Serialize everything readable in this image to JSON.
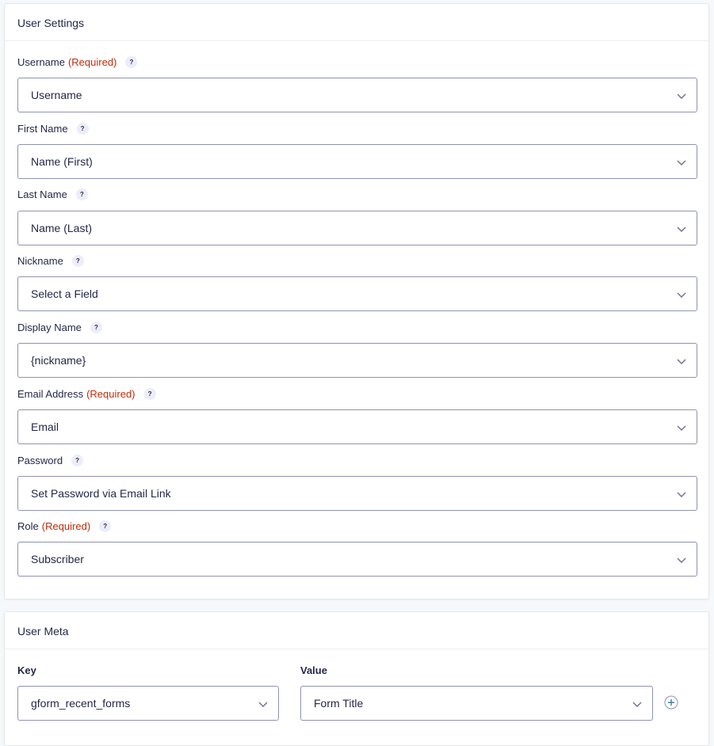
{
  "user_settings": {
    "title": "User Settings",
    "fields": [
      {
        "label": "Username",
        "required": "(Required)",
        "value": "Username"
      },
      {
        "label": "First Name",
        "required": "",
        "value": "Name (First)"
      },
      {
        "label": "Last Name",
        "required": "",
        "value": "Name (Last)"
      },
      {
        "label": "Nickname",
        "required": "",
        "value": "Select a Field"
      },
      {
        "label": "Display Name",
        "required": "",
        "value": "{nickname}"
      },
      {
        "label": "Email Address",
        "required": "(Required)",
        "value": "Email"
      },
      {
        "label": "Password",
        "required": "",
        "value": "Set Password via Email Link"
      },
      {
        "label": "Role",
        "required": "(Required)",
        "value": "Subscriber"
      }
    ],
    "help_glyph": "?"
  },
  "user_meta": {
    "title": "User Meta",
    "key_label": "Key",
    "value_label": "Value",
    "key_value": "gform_recent_forms",
    "value_value": "Form Title"
  },
  "icons": {
    "help": "question-mark-icon",
    "dropdown": "chevron-down-icon",
    "add": "plus-circle-icon"
  },
  "colors": {
    "required": "#c02b0a",
    "text": "#242748",
    "border": "#9092b2",
    "help_bg": "#ecedf8"
  }
}
